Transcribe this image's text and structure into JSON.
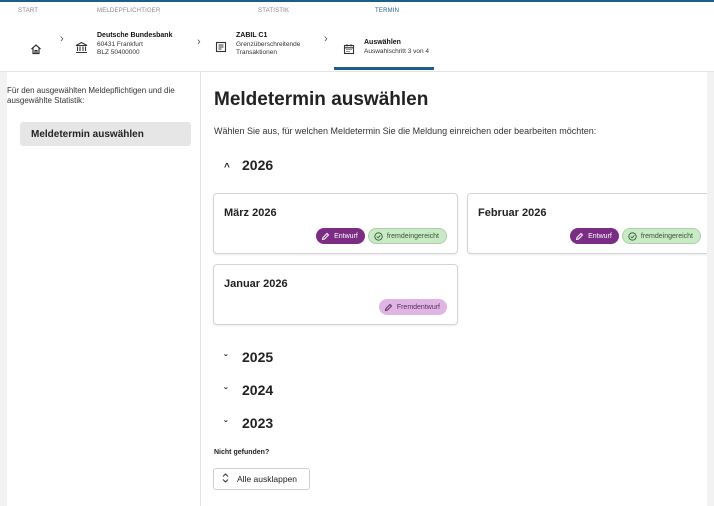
{
  "wizard": {
    "steps": [
      {
        "label": "START"
      },
      {
        "label": "MELDEPFLICHTIGER"
      },
      {
        "label": "STATISTIK"
      },
      {
        "label": "TERMIN"
      }
    ],
    "reporter": {
      "name": "Deutsche Bundesbank",
      "city": "60431 Frankfurt",
      "blz": "BLZ 50400000"
    },
    "statistic": {
      "code": "ZABIL C1",
      "line1": "Grenzüberschreitende",
      "line2": "Transaktionen"
    },
    "termin": {
      "title": "Auswählen",
      "sub": "Auswahlschritt 3 von 4"
    }
  },
  "sidebar": {
    "description": "Für den ausgewählten Meldepflichtigen und die ausgewählte Statistik:",
    "item": "Meldetermin auswählen"
  },
  "main": {
    "title": "Meldetermin auswählen",
    "intro": "Wählen Sie aus, für welchen Meldetermin Sie die Meldung einreichen oder bearbeiten möchten:",
    "years": [
      {
        "label": "2026",
        "expanded": true,
        "caret": "^"
      },
      {
        "label": "2025",
        "expanded": false,
        "caret": "ˇ"
      },
      {
        "label": "2024",
        "expanded": false,
        "caret": "ˇ"
      },
      {
        "label": "2023",
        "expanded": false,
        "caret": "ˇ"
      }
    ],
    "cards": [
      {
        "title": "März 2026",
        "badges": [
          "Entwurf",
          "fremdeingereicht"
        ]
      },
      {
        "title": "Februar 2026",
        "badges": [
          "Entwurf",
          "fremdeingereicht"
        ]
      },
      {
        "title": "Januar 2026",
        "badges": [
          "Fremdentwurf"
        ]
      }
    ],
    "not_found": "Nicht gefunden?",
    "expand_all": "Alle ausklappen"
  },
  "colors": {
    "accent": "#1b5e8c",
    "entwurf": "#7b2d84",
    "fremdeingereicht": "#c9e9c7",
    "fremdentwurf": "#e0b5e3"
  }
}
